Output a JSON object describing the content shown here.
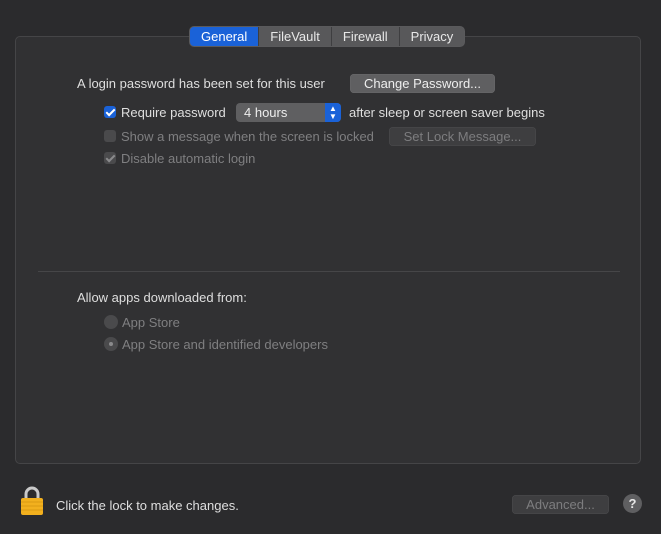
{
  "tabs": [
    {
      "label": "General",
      "active": true
    },
    {
      "label": "FileVault",
      "active": false
    },
    {
      "label": "Firewall",
      "active": false
    },
    {
      "label": "Privacy",
      "active": false
    }
  ],
  "login": {
    "status_text": "A login password has been set for this user",
    "change_password_label": "Change Password..."
  },
  "require_password": {
    "label": "Require password",
    "checked": true,
    "delay_value": "4 hours",
    "suffix": "after sleep or screen saver begins"
  },
  "lock_message": {
    "label": "Show a message when the screen is locked",
    "checked": false,
    "button_label": "Set Lock Message..."
  },
  "auto_login": {
    "label": "Disable automatic login",
    "checked": true
  },
  "downloads": {
    "heading": "Allow apps downloaded from:",
    "options": [
      {
        "label": "App Store",
        "selected": false
      },
      {
        "label": "App Store and identified developers",
        "selected": true
      }
    ]
  },
  "footer": {
    "lock_text": "Click the lock to make changes.",
    "advanced_label": "Advanced...",
    "help_label": "?"
  },
  "colors": {
    "accent": "#1a62d8",
    "lock": "#f2b01e"
  }
}
